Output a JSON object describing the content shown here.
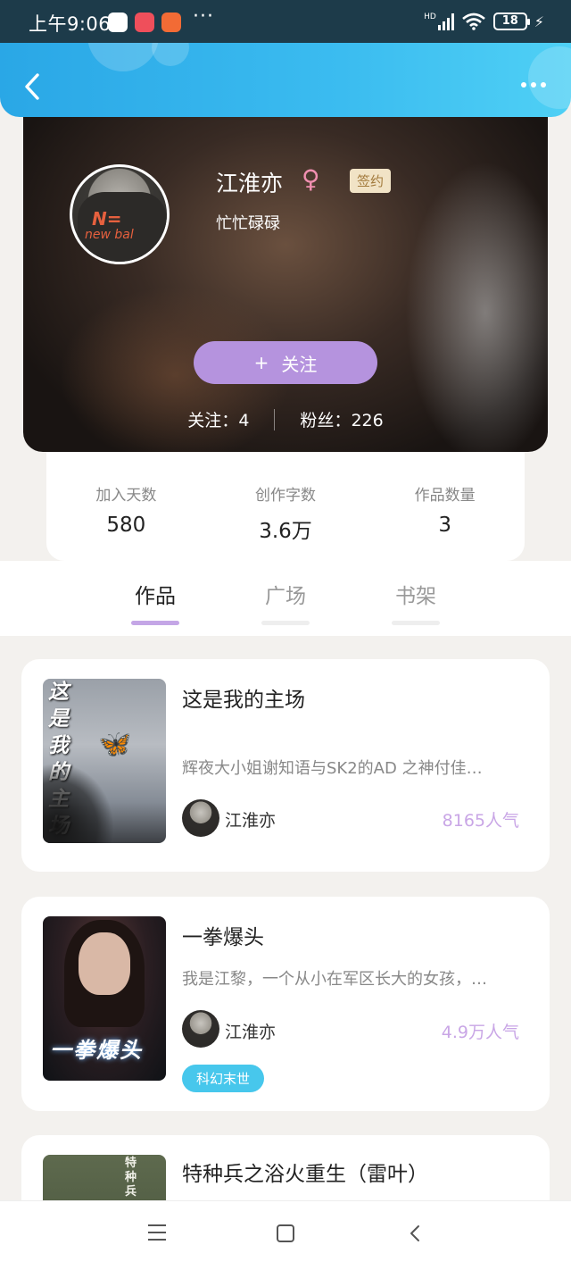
{
  "status_bar": {
    "time": "上午9:06",
    "battery": "18",
    "network": "HD"
  },
  "profile": {
    "name": "江淮亦",
    "gender_symbol": "♀",
    "badge": "签约",
    "motto": "忙忙碌碌",
    "follow_button": "关注",
    "follow_plus": "+",
    "following_label": "关注",
    "following_count": "4",
    "fans_label": "粉丝",
    "fans_count": "226"
  },
  "stats": [
    {
      "label": "加入天数",
      "value": "580"
    },
    {
      "label": "创作字数",
      "value": "3.6万"
    },
    {
      "label": "作品数量",
      "value": "3"
    }
  ],
  "tabs": [
    {
      "label": "作品",
      "active": true
    },
    {
      "label": "广场",
      "active": false
    },
    {
      "label": "书架",
      "active": false
    }
  ],
  "books": [
    {
      "title": "这是我的主场",
      "description": "辉夜大小姐谢知语与SK2的AD 之神付佳…",
      "author": "江淮亦",
      "popularity": "8165人气",
      "cover_text": "这是我的主场"
    },
    {
      "title": "一拳爆头",
      "description": "我是江黎，一个从小在军区长大的女孩，…",
      "author": "江淮亦",
      "popularity": "4.9万人气",
      "tag": "科幻末世",
      "cover_text": "一拳爆头"
    },
    {
      "title": "特种兵之浴火重生（雷叶）",
      "cover_text": "特种兵"
    }
  ],
  "colors": {
    "header_gradient_start": "#2aa7e6",
    "accent_purple": "#b593de",
    "tag_blue": "#47c7ec",
    "popularity": "#c9a6e6"
  }
}
